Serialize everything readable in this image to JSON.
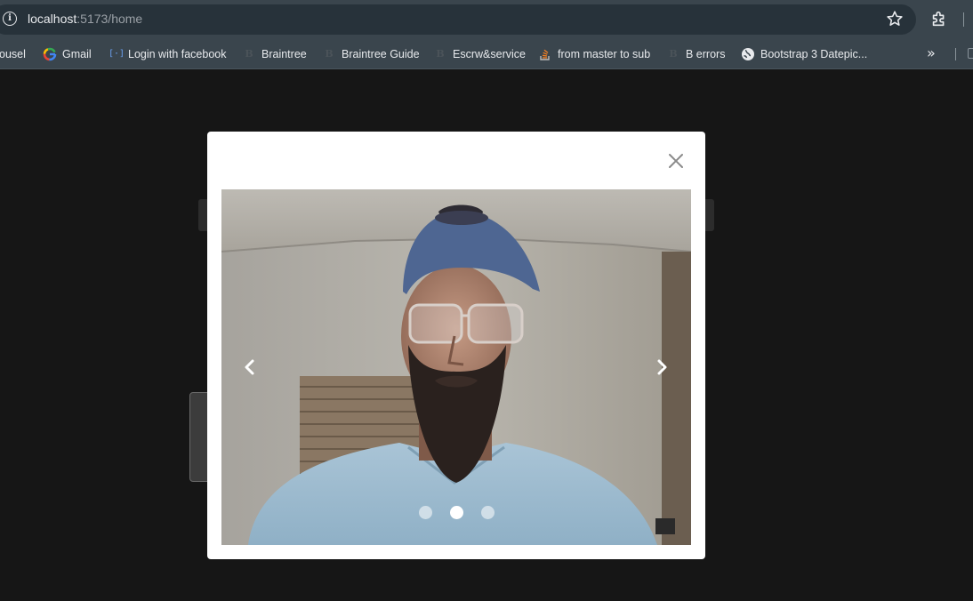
{
  "browser": {
    "url_host": "localhost",
    "url_path": ":5173/home",
    "bookmarks": [
      {
        "label": "ousel",
        "icon": "none"
      },
      {
        "label": "Gmail",
        "icon": "google-icon"
      },
      {
        "label": "Login with facebook",
        "icon": "bracket-icon"
      },
      {
        "label": "Braintree",
        "icon": "b-icon"
      },
      {
        "label": "Braintree Guide",
        "icon": "b-icon"
      },
      {
        "label": "Escrw&service",
        "icon": "b-icon"
      },
      {
        "label": "from master to sub",
        "icon": "stackoverflow-icon"
      },
      {
        "label": "B errors",
        "icon": "b-icon"
      },
      {
        "label": "Bootstrap 3 Datepic...",
        "icon": "globe-icon"
      }
    ],
    "more_bookmarks": "»"
  },
  "modal": {
    "close_label": "×",
    "carousel": {
      "slide_count": 3,
      "active_index": 1,
      "prev_icon": "chevron-left-icon",
      "next_icon": "chevron-right-icon"
    }
  },
  "colors": {
    "page_bg": "#161616",
    "chrome": "#3a454d",
    "omnibox": "#27323a",
    "modal_bg": "#ffffff"
  }
}
